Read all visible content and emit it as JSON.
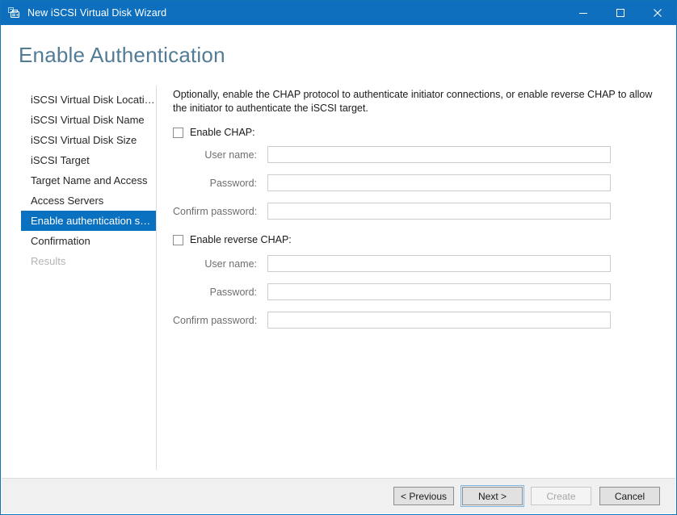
{
  "window": {
    "title": "New iSCSI Virtual Disk Wizard",
    "icon": "iscsi-disk-wizard-icon",
    "controls": [
      {
        "name": "minimize",
        "icon": "minimize-icon"
      },
      {
        "name": "maximize",
        "icon": "maximize-icon"
      },
      {
        "name": "close",
        "icon": "close-icon"
      }
    ],
    "accent_color": "#0d6fbd",
    "border_color": "#1472b8"
  },
  "page": {
    "title": "Enable Authentication"
  },
  "nav": {
    "items": [
      {
        "label": "iSCSI Virtual Disk Location",
        "state": "normal"
      },
      {
        "label": "iSCSI Virtual Disk Name",
        "state": "normal"
      },
      {
        "label": "iSCSI Virtual Disk Size",
        "state": "normal"
      },
      {
        "label": "iSCSI Target",
        "state": "normal"
      },
      {
        "label": "Target Name and Access",
        "state": "normal"
      },
      {
        "label": "Access Servers",
        "state": "normal"
      },
      {
        "label": "Enable authentication ser...",
        "state": "selected"
      },
      {
        "label": "Confirmation",
        "state": "normal"
      },
      {
        "label": "Results",
        "state": "disabled"
      }
    ],
    "selected_color": "#0a70c0"
  },
  "content": {
    "intro": "Optionally, enable the CHAP protocol to authenticate initiator connections, or enable reverse CHAP to allow the initiator to authenticate the iSCSI target.",
    "chap": {
      "checkbox_label": "Enable CHAP:",
      "checked": false,
      "fields": [
        {
          "label": "User name:",
          "value": "",
          "placeholder": ""
        },
        {
          "label": "Password:",
          "value": "",
          "placeholder": ""
        },
        {
          "label": "Confirm password:",
          "value": "",
          "placeholder": ""
        }
      ]
    },
    "reverse_chap": {
      "checkbox_label": "Enable reverse CHAP:",
      "checked": false,
      "fields": [
        {
          "label": "User name:",
          "value": "",
          "placeholder": ""
        },
        {
          "label": "Password:",
          "value": "",
          "placeholder": ""
        },
        {
          "label": "Confirm password:",
          "value": "",
          "placeholder": ""
        }
      ]
    }
  },
  "footer": {
    "buttons": [
      {
        "label": "< Previous",
        "state": "normal"
      },
      {
        "label": "Next >",
        "state": "focused"
      },
      {
        "label": "Create",
        "state": "disabled"
      },
      {
        "label": "Cancel",
        "state": "normal"
      }
    ]
  }
}
